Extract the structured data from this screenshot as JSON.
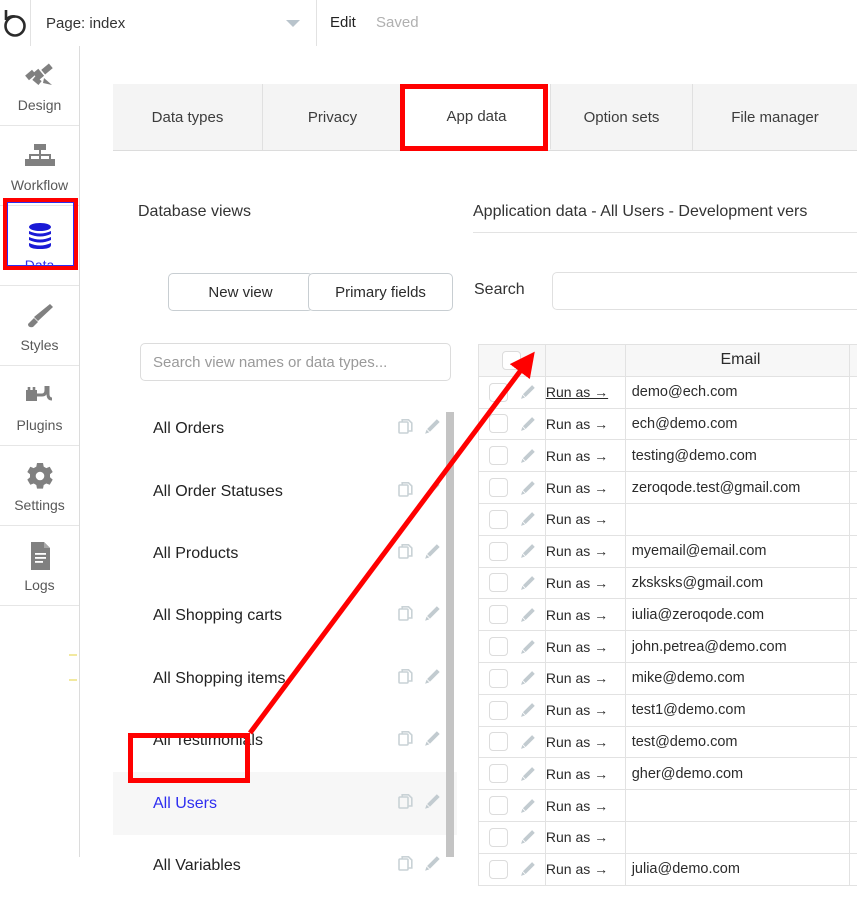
{
  "topbar": {
    "logo_icon": "bubble-logo-icon",
    "page_label": "Page: index",
    "dropdown_icon": "chevron-down-icon",
    "edit_label": "Edit",
    "saved_label": "Saved"
  },
  "sidebar": {
    "items": [
      {
        "label": "Design",
        "icon": "design-tools-icon",
        "active": false
      },
      {
        "label": "Workflow",
        "icon": "workflow-tree-icon",
        "active": false
      },
      {
        "label": "Data",
        "icon": "database-icon",
        "active": true
      },
      {
        "label": "Styles",
        "icon": "paintbrush-icon",
        "active": false
      },
      {
        "label": "Plugins",
        "icon": "plug-icon",
        "active": false
      },
      {
        "label": "Settings",
        "icon": "gear-icon",
        "active": false
      },
      {
        "label": "Logs",
        "icon": "document-lines-icon",
        "active": false
      }
    ]
  },
  "tabs": [
    {
      "label": "Data types",
      "selected": false
    },
    {
      "label": "Privacy",
      "selected": false
    },
    {
      "label": "App data",
      "selected": true
    },
    {
      "label": "Option sets",
      "selected": false
    },
    {
      "label": "File manager",
      "selected": false
    }
  ],
  "left_panel": {
    "title": "Database views",
    "new_view_label": "New view",
    "primary_fields_label": "Primary fields",
    "search_placeholder": "Search view names or data types...",
    "search_value": "",
    "copy_icon": "copy-icon",
    "edit_icon": "pencil-icon",
    "views": [
      {
        "name": "All Orders",
        "selected": false
      },
      {
        "name": "All Order Statuses",
        "selected": false
      },
      {
        "name": "All Products",
        "selected": false
      },
      {
        "name": "All Shopping carts",
        "selected": false
      },
      {
        "name": "All Shopping items",
        "selected": false
      },
      {
        "name": "All Testimonials",
        "selected": false
      },
      {
        "name": "All Users",
        "selected": true
      },
      {
        "name": "All Variables",
        "selected": false
      }
    ]
  },
  "right_panel": {
    "title": "Application data - All Users - Development vers",
    "search_label": "Search",
    "search_value": "",
    "search_placeholder": "",
    "table": {
      "columns": [
        "",
        "",
        "Email",
        ""
      ],
      "run_as_label": "Run as →",
      "checkbox_icon": "checkbox-icon",
      "row_edit_icon": "pencil-icon",
      "rows": [
        {
          "email": "demo@ech.com"
        },
        {
          "email": "ech@demo.com"
        },
        {
          "email": "testing@demo.com"
        },
        {
          "email": "zeroqode.test@gmail.com"
        },
        {
          "email": ""
        },
        {
          "email": "myemail@email.com"
        },
        {
          "email": "zksksks@gmail.com"
        },
        {
          "email": "iulia@zeroqode.com"
        },
        {
          "email": "john.petrea@demo.com"
        },
        {
          "email": "mike@demo.com"
        },
        {
          "email": "test1@demo.com"
        },
        {
          "email": "test@demo.com"
        },
        {
          "email": "gher@demo.com"
        },
        {
          "email": ""
        },
        {
          "email": ""
        },
        {
          "email": "julia@demo.com"
        }
      ]
    }
  },
  "annotations": {
    "highlight_color": "#ff0000",
    "active_color": "#2d2df0",
    "arrow_icon": "annotation-arrow-icon",
    "highlights": [
      "sidebar-item-data",
      "tab-app-data",
      "view-item-all-users"
    ]
  }
}
